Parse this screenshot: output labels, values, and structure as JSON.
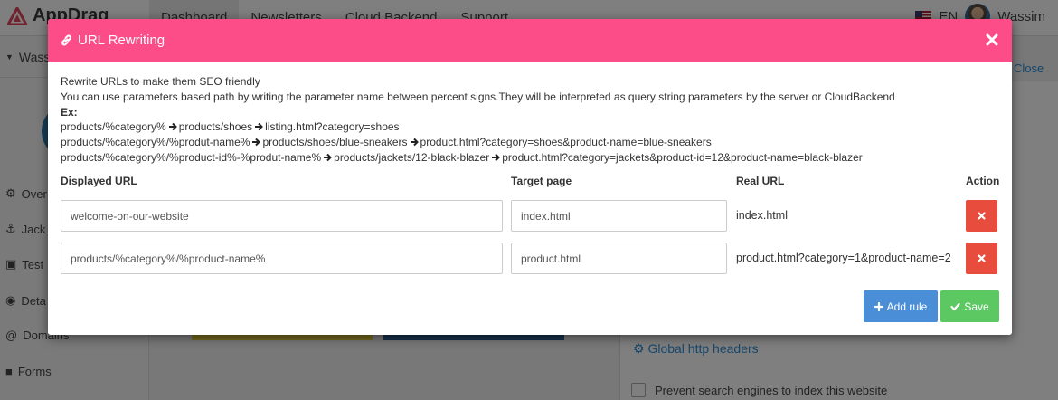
{
  "app": {
    "logo_text": "AppDrag",
    "nav": [
      "Dashboard",
      "Newsletters",
      "Cloud Backend",
      "Support"
    ],
    "language": "EN",
    "user_name": "Wassim"
  },
  "sidebar": {
    "header": "Wass",
    "items": [
      "Over",
      "Jack",
      "Test",
      "Deta",
      "Domains",
      "Forms"
    ]
  },
  "background": {
    "close_link": "Close",
    "http_headers": "Global http headers",
    "prevent_indexing": "Prevent search engines to index this website"
  },
  "modal": {
    "title": "URL Rewriting",
    "intro": "Rewrite URLs to make them SEO friendly",
    "intro2": "You can use parameters based path by writing the parameter name between percent signs.They will be interpreted as query string parameters by the server or CloudBackend",
    "ex_label": "Ex:",
    "examples": [
      [
        "products/%category%",
        "products/shoes",
        "listing.html?category=shoes"
      ],
      [
        "products/%category%/%produt-name%",
        "products/shoes/blue-sneakers",
        "product.html?category=shoes&product-name=blue-sneakers"
      ],
      [
        "products/%category%/%product-id%-%produt-name%",
        "products/jackets/12-black-blazer",
        "product.html?category=jackets&product-id=12&product-name=black-blazer"
      ]
    ],
    "columns": {
      "displayed": "Displayed URL",
      "target": "Target page",
      "real": "Real URL",
      "action": "Action"
    },
    "rows": [
      {
        "displayed": "welcome-on-our-website",
        "target": "index.html",
        "real": "index.html"
      },
      {
        "displayed": "products/%category%/%product-name%",
        "target": "product.html",
        "real": "product.html?category=1&product-name=2"
      }
    ],
    "add_rule_label": "Add rule",
    "save_label": "Save"
  },
  "colors": {
    "header": "#fd4d89",
    "add_button": "#4a8ed8",
    "save_button": "#5cc862",
    "delete_button": "#e74c3c"
  }
}
